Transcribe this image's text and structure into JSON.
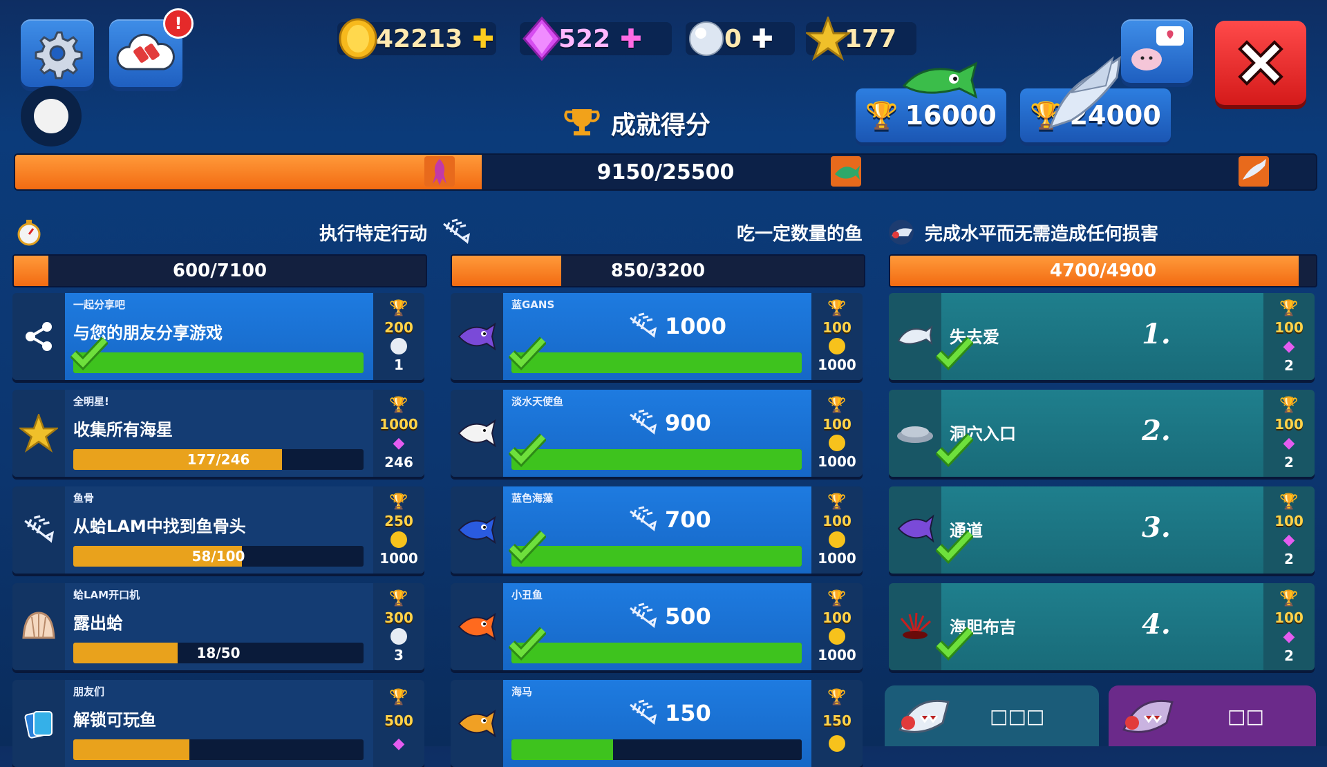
{
  "currencies": {
    "coins": "42213",
    "gems": "522",
    "pearls": "0",
    "starfish": "177"
  },
  "title": "成就得分",
  "score_buttons": [
    "16000",
    "24000"
  ],
  "main_progress": {
    "text": "9150/25500",
    "value": 9150,
    "max": 25500
  },
  "notification_badge": "!",
  "columns": [
    {
      "header": "执行特定行动",
      "progress_text": "600/7100",
      "value": 600,
      "max": 7100
    },
    {
      "header": "吃一定数量的鱼",
      "progress_text": "850/3200",
      "value": 850,
      "max": 3200
    },
    {
      "header": "完成水平而无需造成任何损害",
      "progress_text": "4700/4900",
      "value": 4700,
      "max": 4900
    }
  ],
  "actions": [
    {
      "subtitle": "一起分享吧",
      "title": "与您的朋友分享游戏",
      "progress": "",
      "fraction": 1.0,
      "done": true,
      "trophy": "200",
      "reward": "1",
      "reward_icon": "pearl",
      "icon": "share-icon"
    },
    {
      "subtitle": "全明星!",
      "title": "收集所有海星",
      "progress": "177/246",
      "fraction": 0.72,
      "done": false,
      "trophy": "1000",
      "reward": "246",
      "reward_icon": "gem",
      "icon": "starfish-icon"
    },
    {
      "subtitle": "鱼骨",
      "title": "从蛤LAM中找到鱼骨头",
      "progress": "58/100",
      "fraction": 0.58,
      "done": false,
      "trophy": "250",
      "reward": "1000",
      "reward_icon": "coin",
      "icon": "fishbone-icon"
    },
    {
      "subtitle": "蛤LAM开口机",
      "title": "露出蛤",
      "progress": "18/50",
      "fraction": 0.36,
      "done": false,
      "trophy": "300",
      "reward": "3",
      "reward_icon": "pearl",
      "icon": "clam-icon"
    },
    {
      "subtitle": "朋友们",
      "title": "解锁可玩鱼",
      "progress": "",
      "fraction": 0.4,
      "done": false,
      "trophy": "500",
      "reward": "",
      "reward_icon": "gem",
      "icon": "cards-icon"
    }
  ],
  "fish": [
    {
      "subtitle": "蓝GANS",
      "value": "1000",
      "trophy": "100",
      "reward": "1000",
      "done": true,
      "color": "#7a4ad8"
    },
    {
      "subtitle": "淡水天使鱼",
      "value": "900",
      "trophy": "100",
      "reward": "1000",
      "done": true,
      "color": "#f3f3f3"
    },
    {
      "subtitle": "蓝色海藻",
      "value": "700",
      "trophy": "100",
      "reward": "1000",
      "done": true,
      "color": "#2a5be0"
    },
    {
      "subtitle": "小丑鱼",
      "value": "500",
      "trophy": "100",
      "reward": "1000",
      "done": true,
      "color": "#ff6a1e"
    },
    {
      "subtitle": "海马",
      "value": "150",
      "trophy": "150",
      "reward": "",
      "done": false,
      "color": "#f0a024"
    }
  ],
  "levels": [
    {
      "title": "失去爱",
      "number": "1.",
      "trophy": "100",
      "reward": "2"
    },
    {
      "title": "洞穴入口",
      "number": "2.",
      "trophy": "100",
      "reward": "2"
    },
    {
      "title": "通道",
      "number": "3.",
      "trophy": "100",
      "reward": "2"
    },
    {
      "title": "海胆布吉",
      "number": "4.",
      "trophy": "100",
      "reward": "2"
    }
  ],
  "tabs": [
    {
      "label": "□□□"
    },
    {
      "label": "□□"
    }
  ]
}
